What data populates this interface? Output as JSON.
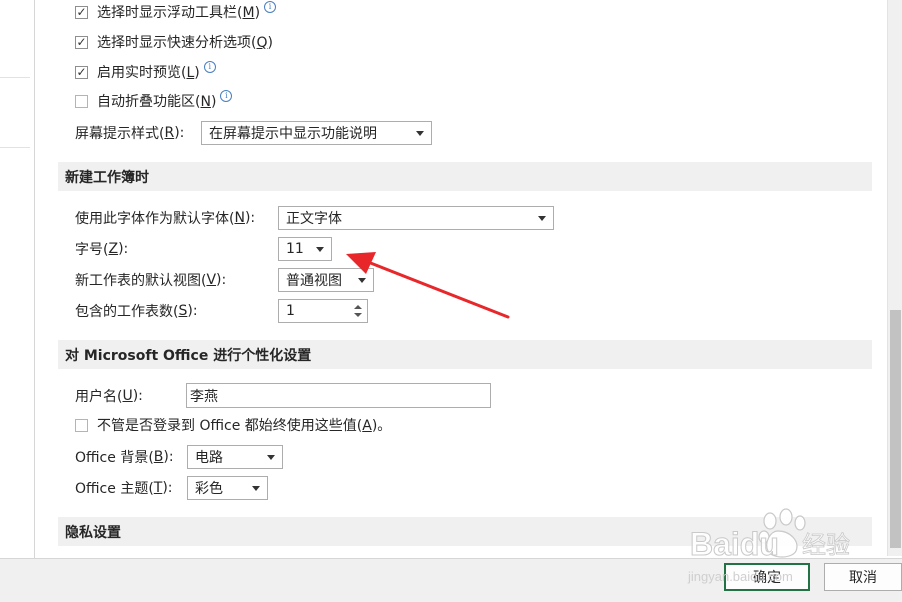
{
  "general_options": {
    "show_mini_toolbar": {
      "label": "选择时显示浮动工具栏(",
      "key": "M",
      "suffix": ")",
      "checked": true
    },
    "show_quick_analysis": {
      "label": "选择时显示快速分析选项(",
      "key": "Q",
      "suffix": ")",
      "checked": true
    },
    "live_preview": {
      "label": "启用实时预览(",
      "key": "L",
      "suffix": ")",
      "checked": true
    },
    "collapse_ribbon": {
      "label": "自动折叠功能区(",
      "key": "N",
      "suffix": ")",
      "checked": false
    },
    "screentip_style": {
      "label": "屏幕提示样式(",
      "key": "R",
      "suffix": "):",
      "value": "在屏幕提示中显示功能说明"
    }
  },
  "new_workbook": {
    "header": "新建工作簿时",
    "font": {
      "label": "使用此字体作为默认字体(",
      "key": "N",
      "suffix": "):",
      "value": "正文字体"
    },
    "font_size": {
      "label": "字号(",
      "key": "Z",
      "suffix": "):",
      "value": "11"
    },
    "default_view": {
      "label": "新工作表的默认视图(",
      "key": "V",
      "suffix": "):",
      "value": "普通视图"
    },
    "sheet_count": {
      "label": "包含的工作表数(",
      "key": "S",
      "suffix": "):",
      "value": "1"
    }
  },
  "personalize": {
    "header": "对 Microsoft Office 进行个性化设置",
    "username": {
      "label": "用户名(",
      "key": "U",
      "suffix": "):",
      "value": "李燕"
    },
    "always_use": {
      "label": "不管是否登录到 Office 都始终使用这些值(",
      "key": "A",
      "suffix": ")。",
      "checked": false
    },
    "background": {
      "label": "Office 背景(",
      "key": "B",
      "suffix": "):",
      "value": "电路"
    },
    "theme": {
      "label": "Office 主题(",
      "key": "T",
      "suffix": "):",
      "value": "彩色"
    }
  },
  "privacy": {
    "header": "隐私设置"
  },
  "footer": {
    "ok": "确定",
    "cancel": "取消"
  },
  "annotation": {
    "arrow_color": "#e8272b"
  },
  "watermark": {
    "brand": "Baidu",
    "product": "经验",
    "url": "jingyan.baidu.com"
  },
  "colors": {
    "section_bg": "#f0f0f0",
    "accent_green": "#217346",
    "info_blue": "#4a7fc1"
  }
}
